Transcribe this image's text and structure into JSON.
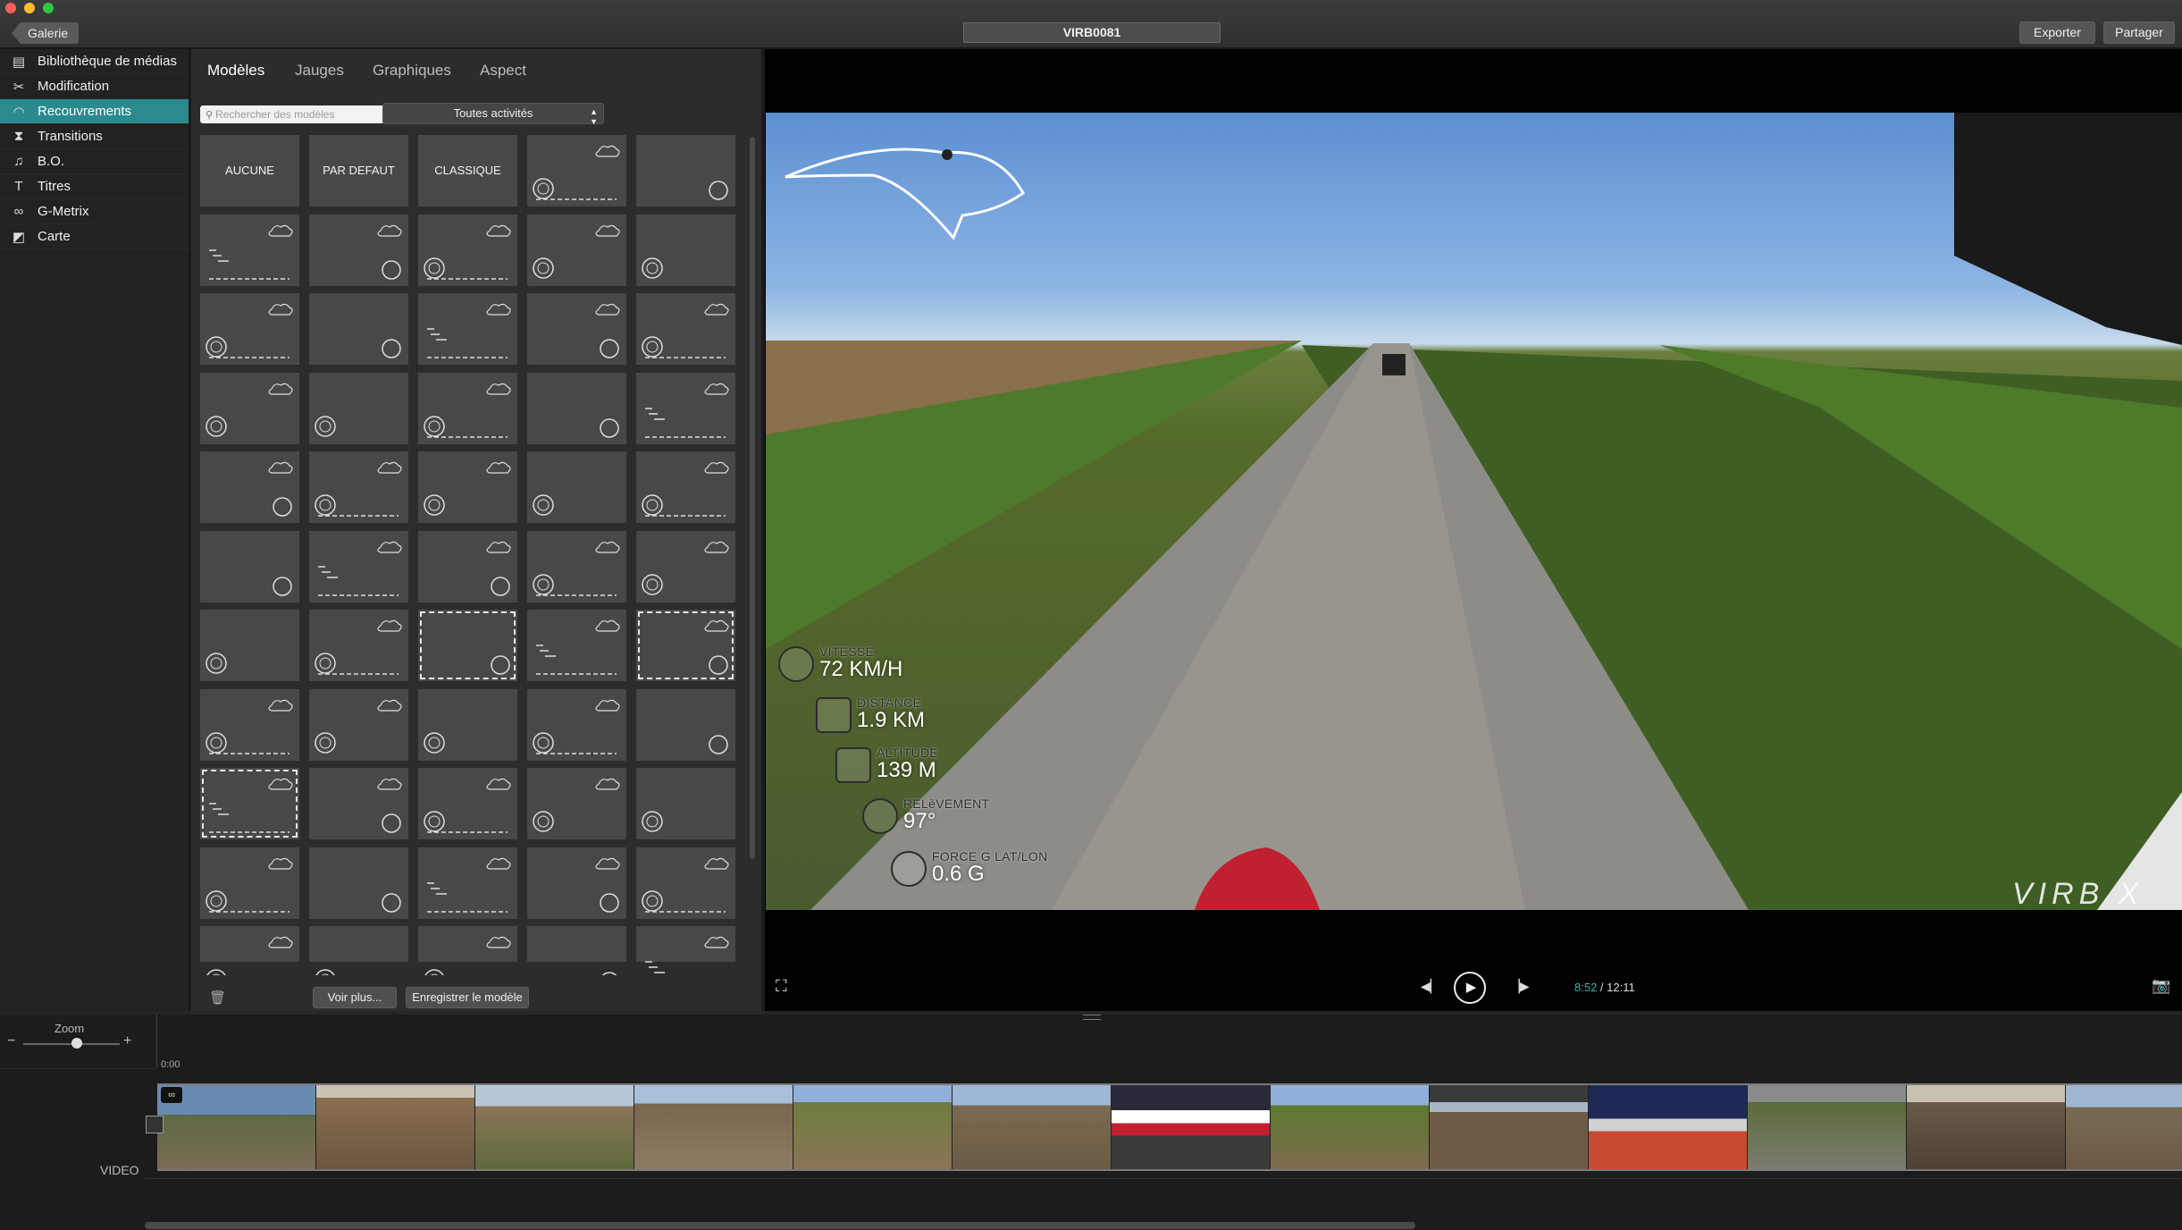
{
  "window": {
    "gallery_label": "Galerie",
    "title": "VIRB0081",
    "export_label": "Exporter",
    "share_label": "Partager"
  },
  "sidebar": {
    "items": [
      {
        "label": "Bibliothèque de médias",
        "icon": "film-icon"
      },
      {
        "label": "Modification",
        "icon": "scissors-icon"
      },
      {
        "label": "Recouvrements",
        "icon": "gauge-icon",
        "active": true
      },
      {
        "label": "Transitions",
        "icon": "transition-icon"
      },
      {
        "label": "B.O.",
        "icon": "music-note-icon"
      },
      {
        "label": "Titres",
        "icon": "text-icon"
      },
      {
        "label": "G-Metrix",
        "icon": "gmetrix-icon"
      },
      {
        "label": "Carte",
        "icon": "map-icon"
      }
    ]
  },
  "panel": {
    "tabs": [
      "Modèles",
      "Jauges",
      "Graphiques",
      "Aspect"
    ],
    "active_tab": "Modèles",
    "search_placeholder": "Rechercher des modèles",
    "activity_filter": "Toutes activités",
    "preset_tiles": [
      "AUCUNE",
      "PAR DEFAUT",
      "CLASSIQUE"
    ],
    "more_label": "Voir plus...",
    "save_label": "Enregistrer le modèle"
  },
  "overlay": {
    "metrics": [
      {
        "label": "VITESSE",
        "value": "72 KM/H"
      },
      {
        "label": "DISTANCE",
        "value": "1.9 KM"
      },
      {
        "label": "ALTITUDE",
        "value": "139 M"
      },
      {
        "label": "RELèVEMENT",
        "value": "97°"
      },
      {
        "label": "FORCE G LAT/LON",
        "value": "0.6 G"
      }
    ],
    "logo": "VIRB X"
  },
  "player": {
    "time_current": "8:52",
    "time_separator": " / ",
    "time_total": "12:11"
  },
  "timeline": {
    "zoom_label": "Zoom",
    "zoom_minus": "−",
    "zoom_plus": "+",
    "ruler_start": "0:00",
    "track_label": "VIDEO"
  },
  "colors": {
    "accent": "#2b8a8d",
    "time_current": "#3fb0b4"
  }
}
